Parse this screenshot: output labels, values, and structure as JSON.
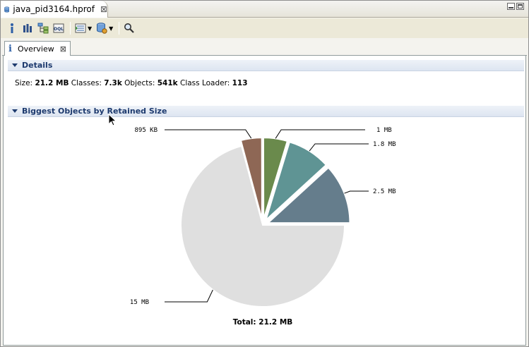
{
  "editor_tab": {
    "label": "java_pid3164.hprof",
    "close": "⊠"
  },
  "toolbar": {
    "buttons": [
      "info-icon",
      "histogram-icon",
      "dominator-tree-icon",
      "oql-icon",
      "query-browser-icon",
      "heap-dump-overview-icon",
      "search-icon"
    ]
  },
  "inner_tab": {
    "icon": "i",
    "label": "Overview",
    "close": "⊠"
  },
  "details": {
    "title": "Details",
    "size_label": "Size:",
    "size_value": "21.2 MB",
    "classes_label": "Classes:",
    "classes_value": "7.3k",
    "objects_label": "Objects:",
    "objects_value": "541k",
    "classloader_label": "Class Loader:",
    "classloader_value": "113"
  },
  "biggest_objects": {
    "title": "Biggest Objects by Retained Size",
    "total_label": "Total: 21.2 MB"
  },
  "chart_data": {
    "type": "pie",
    "title": "",
    "slices": [
      {
        "label": "2.5 MB",
        "value": 2.5,
        "color": "#657d8c"
      },
      {
        "label": "1.8 MB",
        "value": 1.8,
        "color": "#5f9494"
      },
      {
        "label": "1 MB",
        "value": 1.0,
        "color": "#6a8a4c"
      },
      {
        "label": "895 KB",
        "value": 0.874,
        "color": "#8e6755"
      },
      {
        "label": "15 MB",
        "value": 15.0,
        "color": "#dfdfdf"
      }
    ],
    "total": "21.2 MB"
  }
}
